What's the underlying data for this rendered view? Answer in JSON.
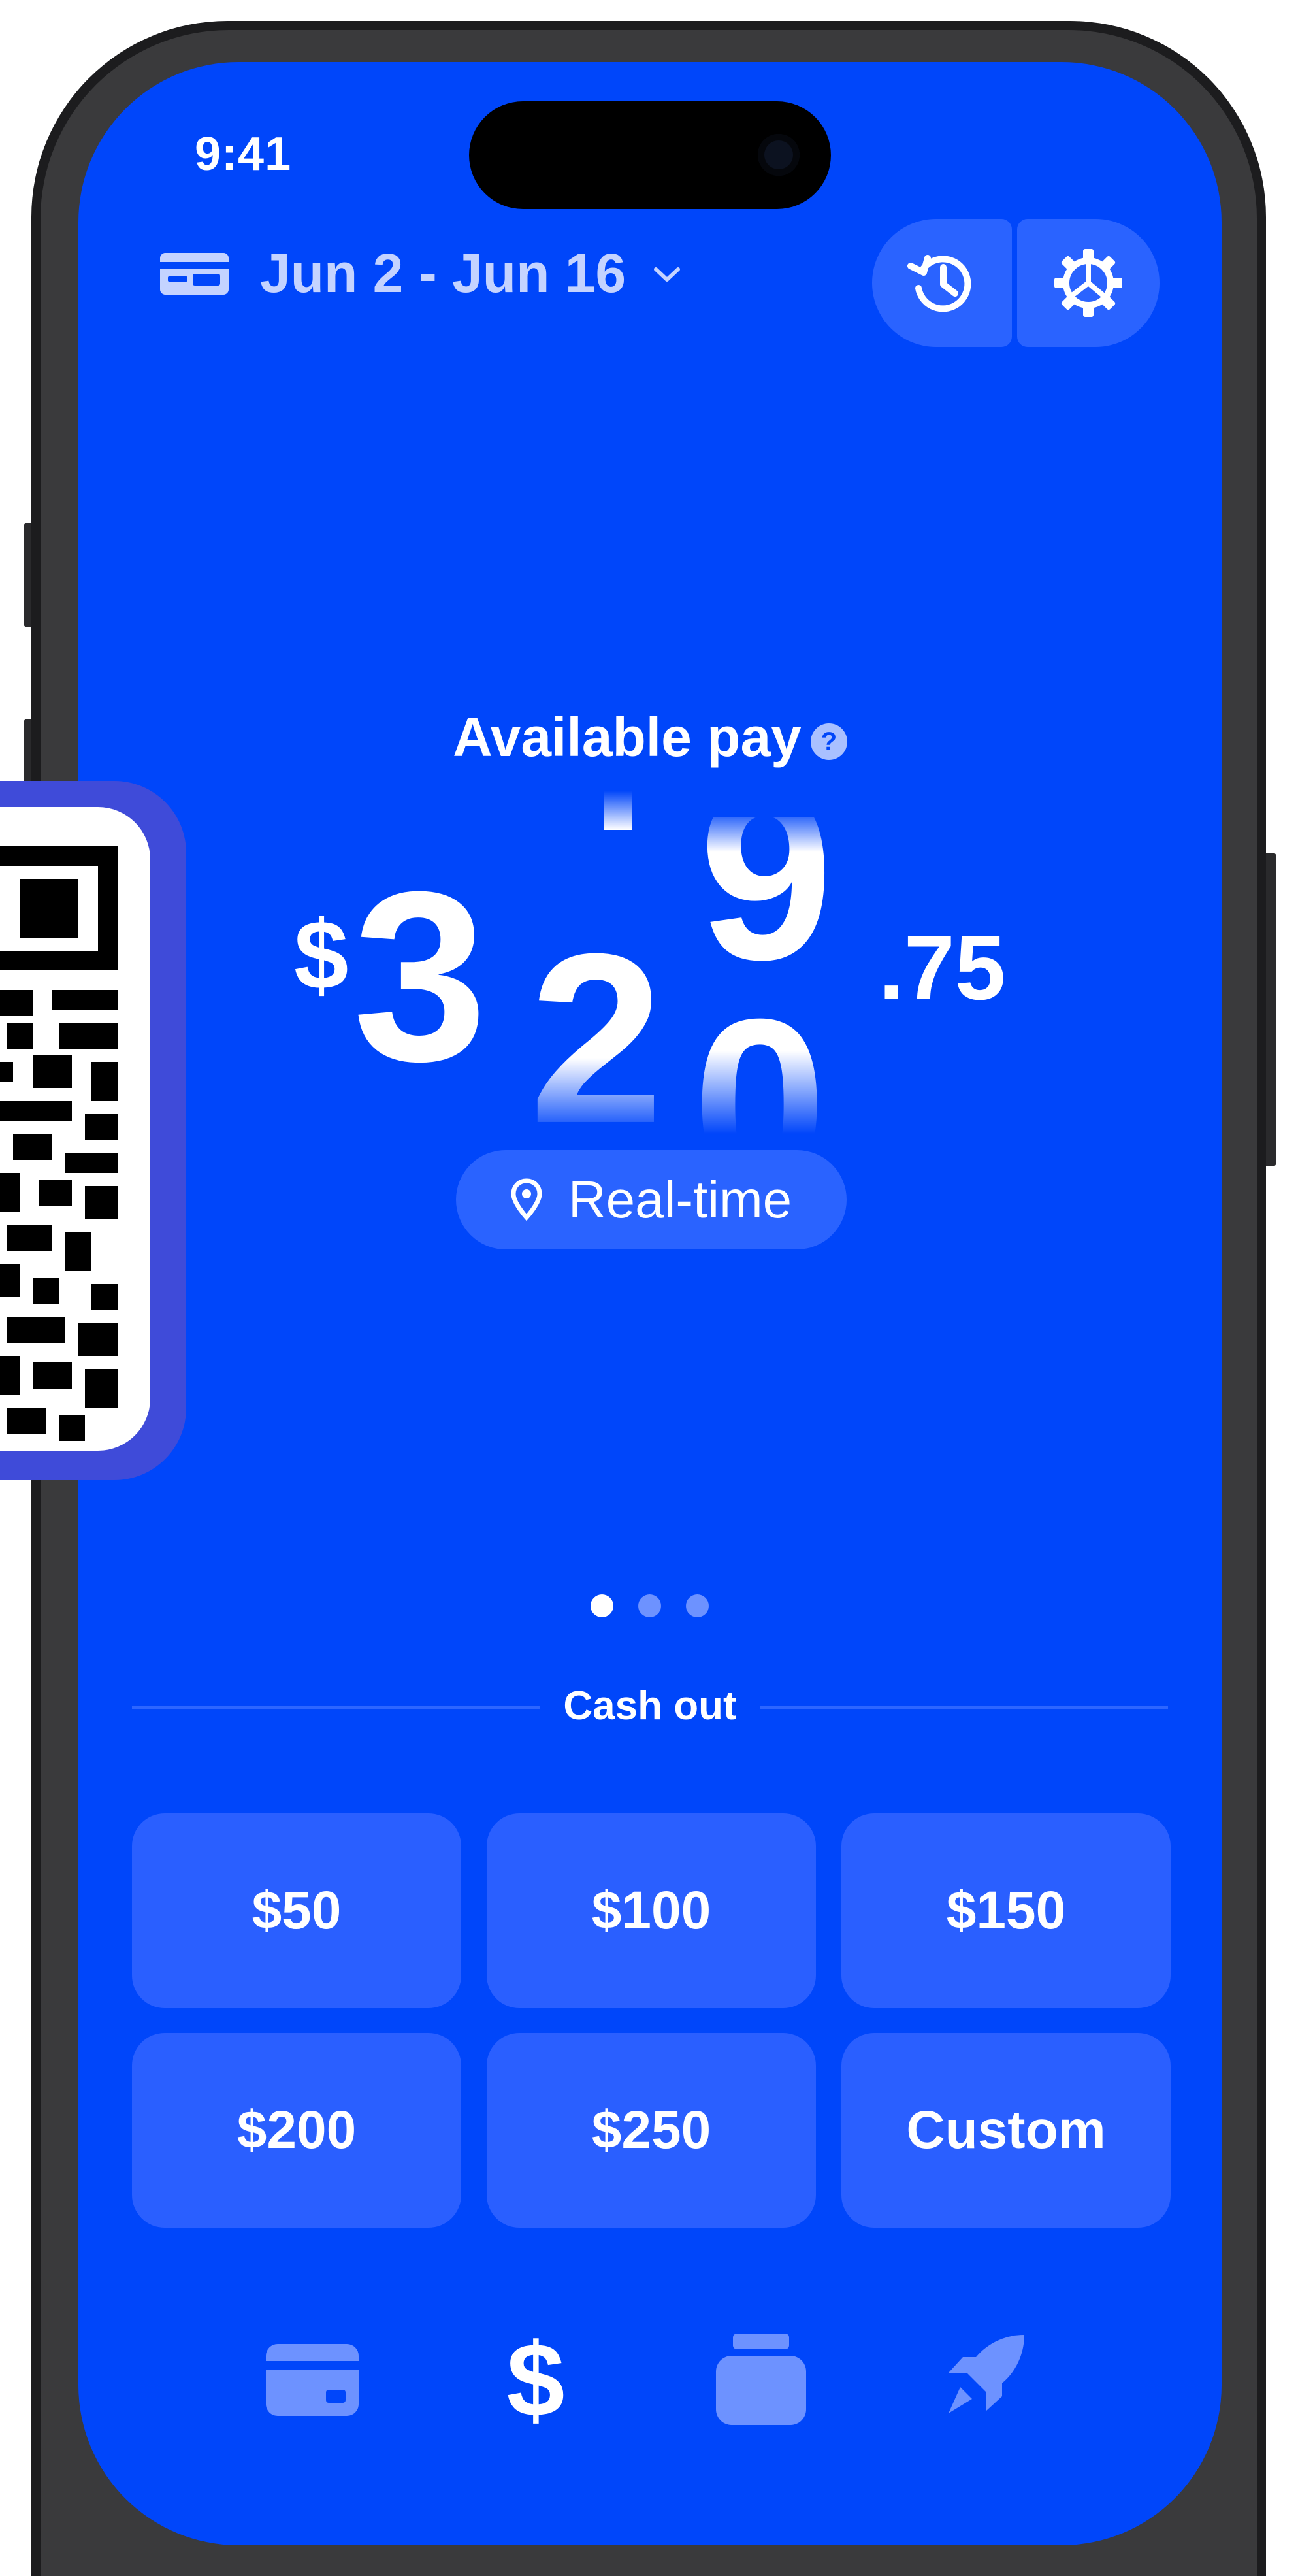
{
  "status_bar": {
    "time": "9:41"
  },
  "header": {
    "pay_period": "Jun 2 - Jun 16",
    "icons": [
      "card-icon",
      "chevron-down-icon",
      "history-icon",
      "settings-icon"
    ]
  },
  "pay": {
    "label": "Available pay",
    "help": "?",
    "currency": "$",
    "digits_visible": [
      "3",
      "2",
      "0",
      "9"
    ],
    "cents": ".75",
    "mode_label": "Real-time"
  },
  "carousel": {
    "pages": 3,
    "active": 0
  },
  "cash_out": {
    "title": "Cash out",
    "amounts": [
      "$50",
      "$100",
      "$150",
      "$200",
      "$250",
      "Custom"
    ]
  },
  "tab_bar": {
    "items": [
      "wallet-icon",
      "dollar-icon",
      "jar-icon",
      "rocket-icon"
    ],
    "active": "dollar-icon"
  },
  "colors": {
    "background": "#0046fa",
    "button": "#2a5fff",
    "accent_text": "#c4d3ff",
    "qr_frame": "#3f4bd9"
  }
}
